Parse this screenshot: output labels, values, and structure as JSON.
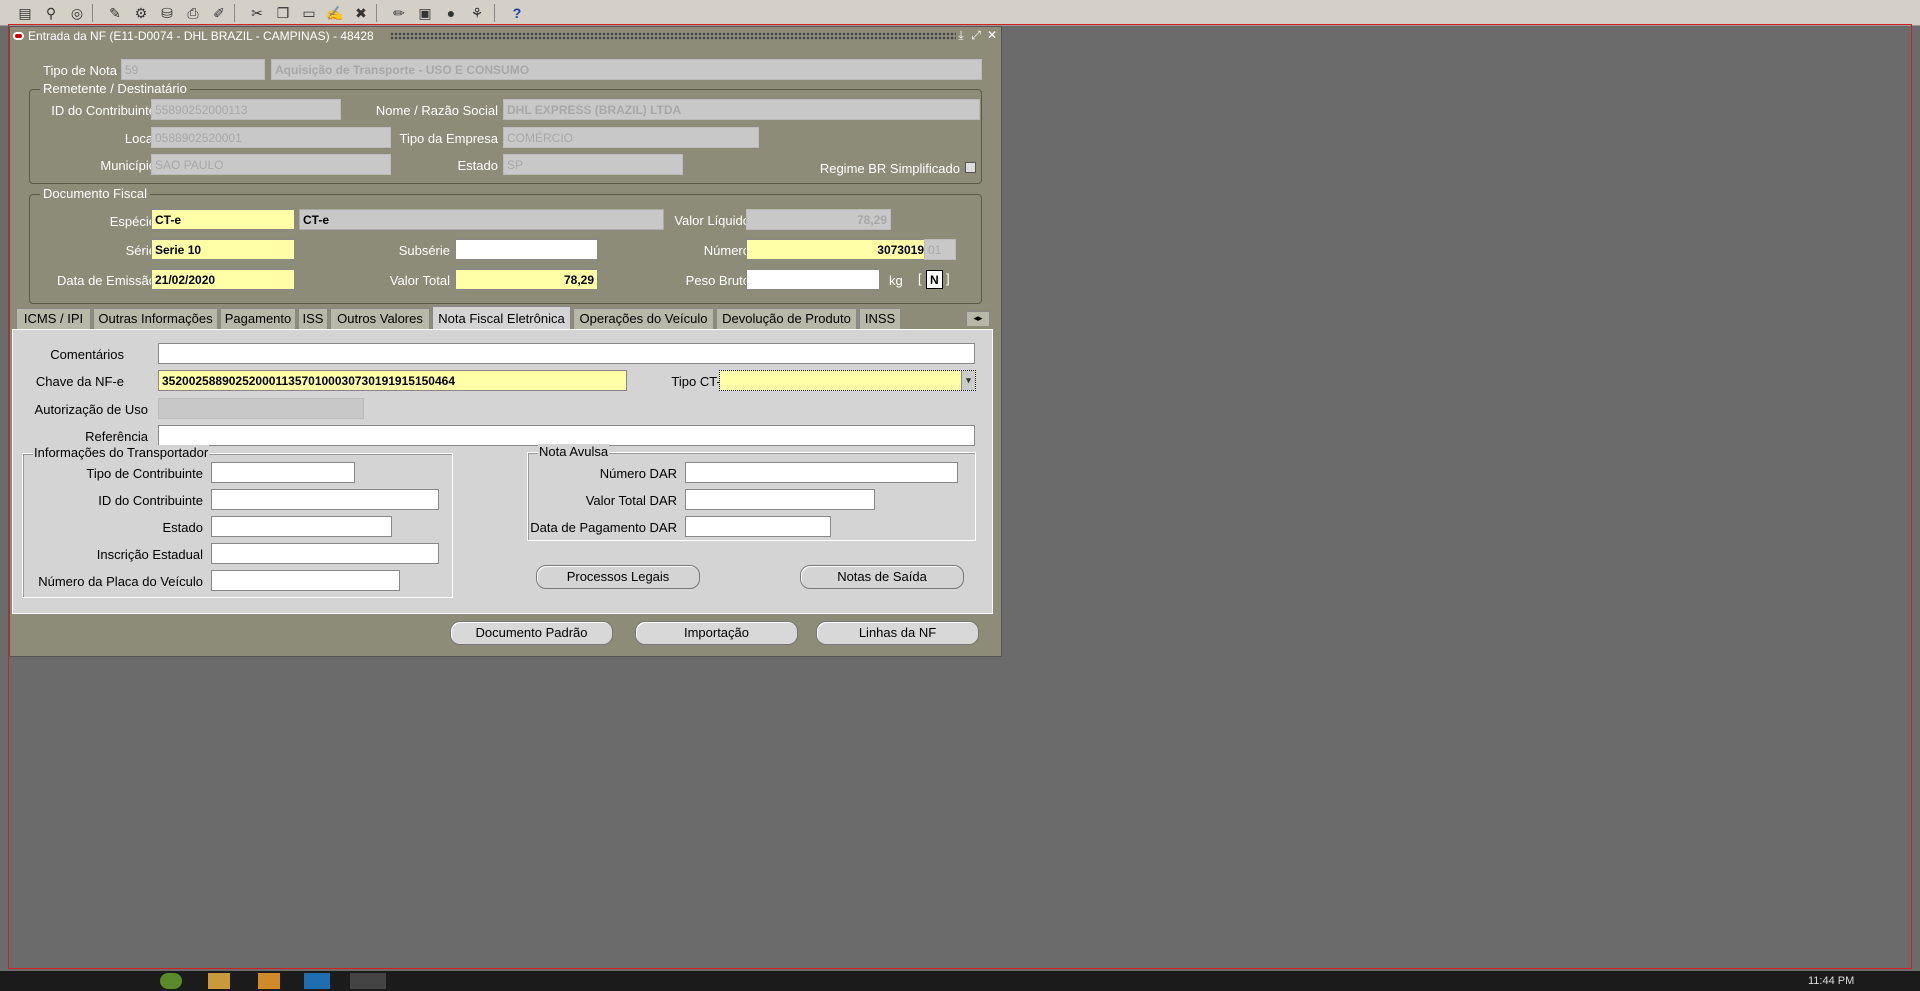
{
  "window": {
    "title": "Entrada da NF (E11-D0074 - DHL BRAZIL - CAMPINAS) - 48428"
  },
  "header": {
    "tipo_nota_label": "Tipo de Nota",
    "tipo_nota_code": "59",
    "tipo_nota_desc": "Aquisição de Transporte - USO E CONSUMO"
  },
  "remetente": {
    "group_title": "Remetente / Destinatário",
    "id_contribuinte_label": "ID do Contribuinte",
    "id_contribuinte": "55890252000113",
    "nome_label": "Nome / Razão Social",
    "nome": "DHL EXPRESS (BRAZIL) LTDA",
    "local_label": "Local",
    "local": "0588902520001",
    "tipo_empresa_label": "Tipo da Empresa",
    "tipo_empresa": "COMÉRCIO",
    "municipio_label": "Município",
    "municipio": "SAO PAULO",
    "estado_label": "Estado",
    "estado": "SP",
    "regime_label": "Regime BR Simplificado"
  },
  "documento": {
    "group_title": "Documento Fiscal",
    "especie_label": "Espécie",
    "especie": "CT-e",
    "especie_desc": "CT-e",
    "valor_liquido_label": "Valor Líquido",
    "valor_liquido": "78,29",
    "serie_label": "Série",
    "serie": "Serie 10",
    "subserie_label": "Subsérie",
    "subserie": "",
    "numero_label": "Número",
    "numero": "3073019",
    "numero_suffix": "01",
    "data_emissao_label": "Data de Emissão",
    "data_emissao": "21/02/2020",
    "valor_total_label": "Valor Total",
    "valor_total": "78,29",
    "peso_bruto_label": "Peso Bruto",
    "peso_bruto": "",
    "kg_label": "kg",
    "flag_open": "[",
    "flag_value": "N",
    "flag_close": "]"
  },
  "tabs": [
    {
      "label": "ICMS / IPI"
    },
    {
      "label": "Outras Informações"
    },
    {
      "label": "Pagamento"
    },
    {
      "label": "ISS"
    },
    {
      "label": "Outros Valores"
    },
    {
      "label": "Nota Fiscal Eletrônica"
    },
    {
      "label": "Operações do Veículo"
    },
    {
      "label": "Devolução de Produto"
    },
    {
      "label": "INSS"
    }
  ],
  "nfe": {
    "comentarios_label": "Comentários",
    "comentarios": "",
    "chave_label": "Chave da NF-e",
    "chave": "35200258890252000113570100030730191915150464",
    "tipo_cte_label": "Tipo CT-e",
    "tipo_cte": "",
    "autorizacao_label": "Autorização de Uso",
    "autorizacao": "",
    "referencia_label": "Referência",
    "referencia": ""
  },
  "transportador": {
    "group_title": "Informações do Transportador",
    "tipo_contribuinte_label": "Tipo de Contribuinte",
    "id_contribuinte_label": "ID do Contribuinte",
    "estado_label": "Estado",
    "inscricao_label": "Inscrição Estadual",
    "placa_label": "Número da Placa do Veículo"
  },
  "avulsa": {
    "group_title": "Nota Avulsa",
    "numero_dar_label": "Número DAR",
    "valor_total_dar_label": "Valor Total DAR",
    "data_pagamento_label": "Data de Pagamento DAR"
  },
  "buttons": {
    "processos_legais": "Processos Legais",
    "notas_saida": "Notas de Saída",
    "documento_padrao": "Documento Padrão",
    "importacao": "Importação",
    "linhas_nf": "Linhas da NF"
  },
  "taskbar": {
    "clock": "11:44 PM"
  },
  "colors": {
    "window_bg": "#8c8c78",
    "desktop_bg": "#6b6b6b",
    "required_field": "#ffffa8",
    "frame_border": "#d42020"
  }
}
